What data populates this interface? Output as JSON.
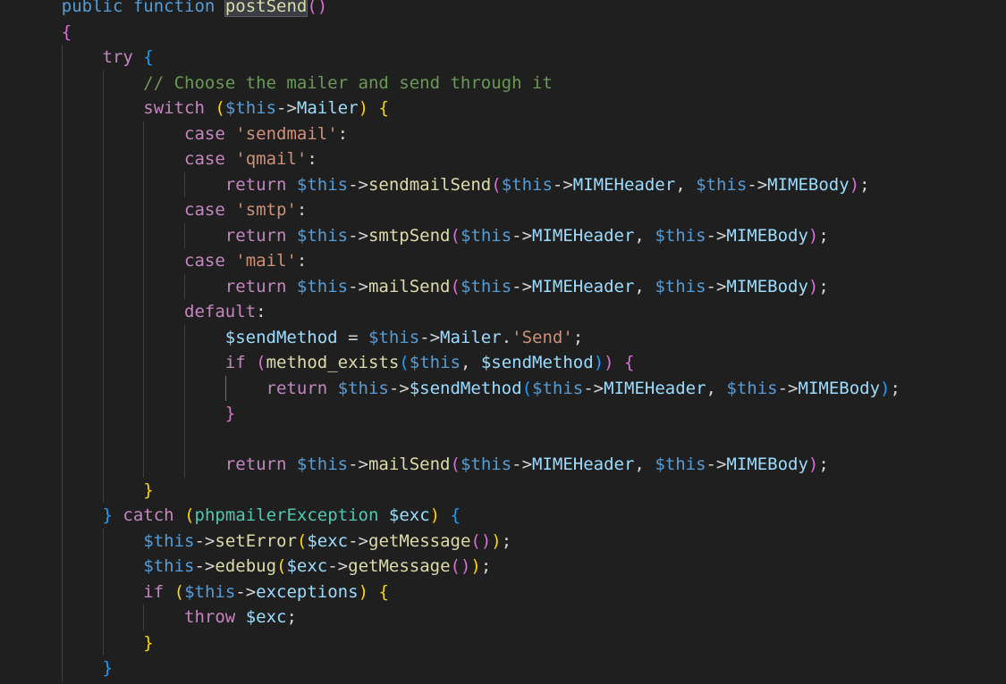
{
  "editor": {
    "lines": [
      [
        {
          "t": "    "
        },
        {
          "t": "public",
          "c": "kw"
        },
        {
          "t": " "
        },
        {
          "t": "function",
          "c": "kw"
        },
        {
          "t": " "
        },
        {
          "t": "postSend",
          "c": "fn",
          "hl": true
        },
        {
          "t": "()",
          "c": "b2"
        }
      ],
      [
        {
          "t": "    "
        },
        {
          "t": "{",
          "c": "b2"
        }
      ],
      [
        {
          "t": "        "
        },
        {
          "t": "try",
          "c": "ctl"
        },
        {
          "t": " "
        },
        {
          "t": "{",
          "c": "b3"
        }
      ],
      [
        {
          "t": "            "
        },
        {
          "t": "// Choose the mailer and send through it",
          "c": "cmt"
        }
      ],
      [
        {
          "t": "            "
        },
        {
          "t": "switch",
          "c": "ctl"
        },
        {
          "t": " "
        },
        {
          "t": "(",
          "c": "b1"
        },
        {
          "t": "$this",
          "c": "this"
        },
        {
          "t": "->"
        },
        {
          "t": "Mailer",
          "c": "var"
        },
        {
          "t": ")",
          "c": "b1"
        },
        {
          "t": " "
        },
        {
          "t": "{",
          "c": "b1"
        }
      ],
      [
        {
          "t": "                "
        },
        {
          "t": "case",
          "c": "ctl"
        },
        {
          "t": " "
        },
        {
          "t": "'sendmail'",
          "c": "str"
        },
        {
          "t": ":"
        }
      ],
      [
        {
          "t": "                "
        },
        {
          "t": "case",
          "c": "ctl"
        },
        {
          "t": " "
        },
        {
          "t": "'qmail'",
          "c": "str"
        },
        {
          "t": ":"
        }
      ],
      [
        {
          "t": "                    "
        },
        {
          "t": "return",
          "c": "ctl"
        },
        {
          "t": " "
        },
        {
          "t": "$this",
          "c": "this"
        },
        {
          "t": "->"
        },
        {
          "t": "sendmailSend",
          "c": "fn"
        },
        {
          "t": "(",
          "c": "b2"
        },
        {
          "t": "$this",
          "c": "this"
        },
        {
          "t": "->"
        },
        {
          "t": "MIMEHeader",
          "c": "var"
        },
        {
          "t": ", "
        },
        {
          "t": "$this",
          "c": "this"
        },
        {
          "t": "->"
        },
        {
          "t": "MIMEBody",
          "c": "var"
        },
        {
          "t": ")",
          "c": "b2"
        },
        {
          "t": ";"
        }
      ],
      [
        {
          "t": "                "
        },
        {
          "t": "case",
          "c": "ctl"
        },
        {
          "t": " "
        },
        {
          "t": "'smtp'",
          "c": "str"
        },
        {
          "t": ":"
        }
      ],
      [
        {
          "t": "                    "
        },
        {
          "t": "return",
          "c": "ctl"
        },
        {
          "t": " "
        },
        {
          "t": "$this",
          "c": "this"
        },
        {
          "t": "->"
        },
        {
          "t": "smtpSend",
          "c": "fn"
        },
        {
          "t": "(",
          "c": "b2"
        },
        {
          "t": "$this",
          "c": "this"
        },
        {
          "t": "->"
        },
        {
          "t": "MIMEHeader",
          "c": "var"
        },
        {
          "t": ", "
        },
        {
          "t": "$this",
          "c": "this"
        },
        {
          "t": "->"
        },
        {
          "t": "MIMEBody",
          "c": "var"
        },
        {
          "t": ")",
          "c": "b2"
        },
        {
          "t": ";"
        }
      ],
      [
        {
          "t": "                "
        },
        {
          "t": "case",
          "c": "ctl"
        },
        {
          "t": " "
        },
        {
          "t": "'mail'",
          "c": "str"
        },
        {
          "t": ":"
        }
      ],
      [
        {
          "t": "                    "
        },
        {
          "t": "return",
          "c": "ctl"
        },
        {
          "t": " "
        },
        {
          "t": "$this",
          "c": "this"
        },
        {
          "t": "->"
        },
        {
          "t": "mailSend",
          "c": "fn"
        },
        {
          "t": "(",
          "c": "b2"
        },
        {
          "t": "$this",
          "c": "this"
        },
        {
          "t": "->"
        },
        {
          "t": "MIMEHeader",
          "c": "var"
        },
        {
          "t": ", "
        },
        {
          "t": "$this",
          "c": "this"
        },
        {
          "t": "->"
        },
        {
          "t": "MIMEBody",
          "c": "var"
        },
        {
          "t": ")",
          "c": "b2"
        },
        {
          "t": ";"
        }
      ],
      [
        {
          "t": "                "
        },
        {
          "t": "default",
          "c": "ctl"
        },
        {
          "t": ":"
        }
      ],
      [
        {
          "t": "                    "
        },
        {
          "t": "$sendMethod",
          "c": "var"
        },
        {
          "t": " = "
        },
        {
          "t": "$this",
          "c": "this"
        },
        {
          "t": "->"
        },
        {
          "t": "Mailer",
          "c": "var"
        },
        {
          "t": "."
        },
        {
          "t": "'Send'",
          "c": "str"
        },
        {
          "t": ";"
        }
      ],
      [
        {
          "t": "                    "
        },
        {
          "t": "if",
          "c": "ctl"
        },
        {
          "t": " "
        },
        {
          "t": "(",
          "c": "b2"
        },
        {
          "t": "method_exists",
          "c": "fn"
        },
        {
          "t": "(",
          "c": "b3"
        },
        {
          "t": "$this",
          "c": "this"
        },
        {
          "t": ", "
        },
        {
          "t": "$sendMethod",
          "c": "var"
        },
        {
          "t": ")",
          "c": "b3"
        },
        {
          "t": ")",
          "c": "b2"
        },
        {
          "t": " "
        },
        {
          "t": "{",
          "c": "b2"
        }
      ],
      [
        {
          "t": "                        "
        },
        {
          "t": "return",
          "c": "ctl"
        },
        {
          "t": " "
        },
        {
          "t": "$this",
          "c": "this"
        },
        {
          "t": "->"
        },
        {
          "t": "$sendMethod",
          "c": "var"
        },
        {
          "t": "(",
          "c": "b3"
        },
        {
          "t": "$this",
          "c": "this"
        },
        {
          "t": "->"
        },
        {
          "t": "MIMEHeader",
          "c": "var"
        },
        {
          "t": ", "
        },
        {
          "t": "$this",
          "c": "this"
        },
        {
          "t": "->"
        },
        {
          "t": "MIMEBody",
          "c": "var"
        },
        {
          "t": ")",
          "c": "b3"
        },
        {
          "t": ";"
        }
      ],
      [
        {
          "t": "                    "
        },
        {
          "t": "}",
          "c": "b2"
        }
      ],
      [],
      [
        {
          "t": "                    "
        },
        {
          "t": "return",
          "c": "ctl"
        },
        {
          "t": " "
        },
        {
          "t": "$this",
          "c": "this"
        },
        {
          "t": "->"
        },
        {
          "t": "mailSend",
          "c": "fn"
        },
        {
          "t": "(",
          "c": "b2"
        },
        {
          "t": "$this",
          "c": "this"
        },
        {
          "t": "->"
        },
        {
          "t": "MIMEHeader",
          "c": "var"
        },
        {
          "t": ", "
        },
        {
          "t": "$this",
          "c": "this"
        },
        {
          "t": "->"
        },
        {
          "t": "MIMEBody",
          "c": "var"
        },
        {
          "t": ")",
          "c": "b2"
        },
        {
          "t": ";"
        }
      ],
      [
        {
          "t": "            "
        },
        {
          "t": "}",
          "c": "b1"
        }
      ],
      [
        {
          "t": "        "
        },
        {
          "t": "}",
          "c": "b3"
        },
        {
          "t": " "
        },
        {
          "t": "catch",
          "c": "ctl"
        },
        {
          "t": " "
        },
        {
          "t": "(",
          "c": "b1"
        },
        {
          "t": "phpmailerException",
          "c": "type"
        },
        {
          "t": " "
        },
        {
          "t": "$exc",
          "c": "var"
        },
        {
          "t": ")",
          "c": "b1"
        },
        {
          "t": " "
        },
        {
          "t": "{",
          "c": "b3"
        }
      ],
      [
        {
          "t": "            "
        },
        {
          "t": "$this",
          "c": "this"
        },
        {
          "t": "->"
        },
        {
          "t": "setError",
          "c": "fn"
        },
        {
          "t": "(",
          "c": "b1"
        },
        {
          "t": "$exc",
          "c": "var"
        },
        {
          "t": "->"
        },
        {
          "t": "getMessage",
          "c": "fn"
        },
        {
          "t": "()",
          "c": "b2"
        },
        {
          "t": ")",
          "c": "b1"
        },
        {
          "t": ";"
        }
      ],
      [
        {
          "t": "            "
        },
        {
          "t": "$this",
          "c": "this"
        },
        {
          "t": "->"
        },
        {
          "t": "edebug",
          "c": "fn"
        },
        {
          "t": "(",
          "c": "b1"
        },
        {
          "t": "$exc",
          "c": "var"
        },
        {
          "t": "->"
        },
        {
          "t": "getMessage",
          "c": "fn"
        },
        {
          "t": "()",
          "c": "b2"
        },
        {
          "t": ")",
          "c": "b1"
        },
        {
          "t": ";"
        }
      ],
      [
        {
          "t": "            "
        },
        {
          "t": "if",
          "c": "ctl"
        },
        {
          "t": " "
        },
        {
          "t": "(",
          "c": "b1"
        },
        {
          "t": "$this",
          "c": "this"
        },
        {
          "t": "->"
        },
        {
          "t": "exceptions",
          "c": "var"
        },
        {
          "t": ")",
          "c": "b1"
        },
        {
          "t": " "
        },
        {
          "t": "{",
          "c": "b1"
        }
      ],
      [
        {
          "t": "                "
        },
        {
          "t": "throw",
          "c": "ctl"
        },
        {
          "t": " "
        },
        {
          "t": "$exc",
          "c": "var"
        },
        {
          "t": ";"
        }
      ],
      [
        {
          "t": "            "
        },
        {
          "t": "}",
          "c": "b1"
        }
      ],
      [
        {
          "t": "        "
        },
        {
          "t": "}",
          "c": "b3"
        }
      ]
    ]
  }
}
